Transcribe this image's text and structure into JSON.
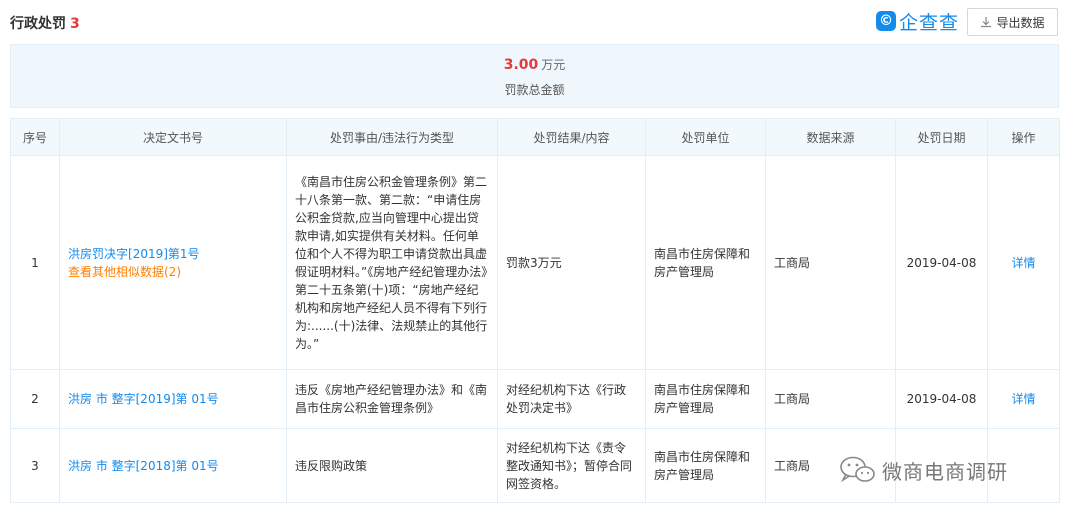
{
  "header": {
    "title": "行政处罚",
    "count": "3",
    "logo_mark": "©",
    "logo_text": "企查查",
    "export_label": "导出数据"
  },
  "summary": {
    "amount": "3.00",
    "unit": "万元",
    "label": "罚款总金额"
  },
  "table": {
    "headers": [
      "序号",
      "决定文书号",
      "处罚事由/违法行为类型",
      "处罚结果/内容",
      "处罚单位",
      "数据来源",
      "处罚日期",
      "操作"
    ],
    "rows": [
      {
        "seq": "1",
        "doc_no": "洪房罚决字[2019]第1号",
        "similar": "查看其他相似数据(2)",
        "reason": "《南昌市住房公积金管理条例》第二十八条第一款、第二款：“申请住房公积金贷款,应当向管理中心提出贷款申请,如实提供有关材料。任何单位和个人不得为职工申请贷款出具虚假证明材料。”《房地产经纪管理办法》第二十五条第(十)项：“房地产经纪机构和房地产经纪人员不得有下列行为:......(十)法律、法规禁止的其他行为。”",
        "result": "罚款3万元",
        "unit": "南昌市住房保障和房产管理局",
        "source": "工商局",
        "date": "2019-04-08",
        "action": "详情"
      },
      {
        "seq": "2",
        "doc_no": "洪房 市 整字[2019]第 01号",
        "reason": "违反《房地产经纪管理办法》和《南昌市住房公积金管理条例》",
        "result": "对经纪机构下达《行政处罚决定书》",
        "unit": "南昌市住房保障和房产管理局",
        "source": "工商局",
        "date": "2019-04-08",
        "action": "详情"
      },
      {
        "seq": "3",
        "doc_no": "洪房 市 整字[2018]第 01号",
        "reason": "违反限购政策",
        "result": "对经纪机构下达《责令整改通知书》；暂停合同网签资格。",
        "unit": "南昌市住房保障和房产管理局",
        "source": "工商局"
      }
    ]
  },
  "watermark": {
    "icon": "wechat-icon",
    "text": "微商电商调研"
  }
}
